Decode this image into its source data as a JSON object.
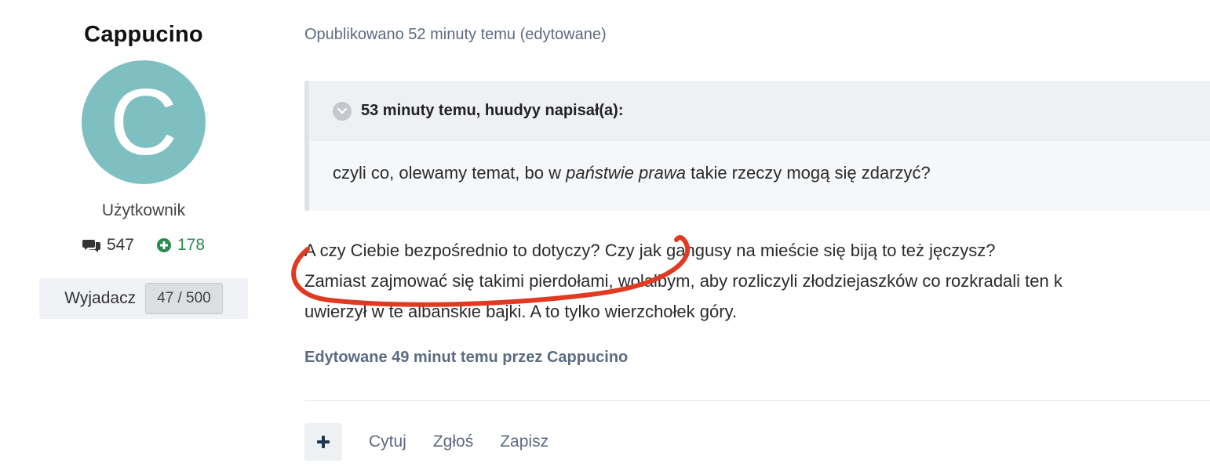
{
  "author": {
    "username": "Cappucino",
    "avatar_letter": "C",
    "avatar_color": "#7ebfc2",
    "group": "Użytkownik",
    "posts_count": "547",
    "reputation": "178",
    "rank_name": "Wyjadacz",
    "rank_progress": "47 / 500"
  },
  "post": {
    "meta": "Opublikowano 52 minuty temu (edytowane)",
    "quote": {
      "header": "53 minuty temu, huudyy napisał(a):",
      "text_before": "czyli co, olewamy temat, bo w ",
      "text_italic": "państwie prawa",
      "text_after": " takie rzeczy mogą się zdarzyć?"
    },
    "content_lines": [
      "A czy Ciebie bezpośrednio to dotyczy? Czy jak gangusy na mieście się biją to też jęczysz?",
      "Zamiast zajmować się takimi pierdołami, wolałbym, aby rozliczyli złodziejaszków co rozkradali ten k",
      "uwierzył w te albańskie bajki. A to tylko wierzchołek góry."
    ],
    "edited_note": "Edytowane 49 minut temu przez Cappucino",
    "actions": {
      "quote_label": "Cytuj",
      "report_label": "Zgłoś",
      "save_label": "Zapisz"
    }
  },
  "colors": {
    "meta_text": "#5b6b82",
    "reputation_green": "#2c8a4d",
    "annotation_red": "#e03a22"
  },
  "icons": {
    "posts": "comments-icon",
    "reputation": "plus-circle-icon",
    "quote_toggle": "chevron-down-icon",
    "more": "plus-icon"
  }
}
